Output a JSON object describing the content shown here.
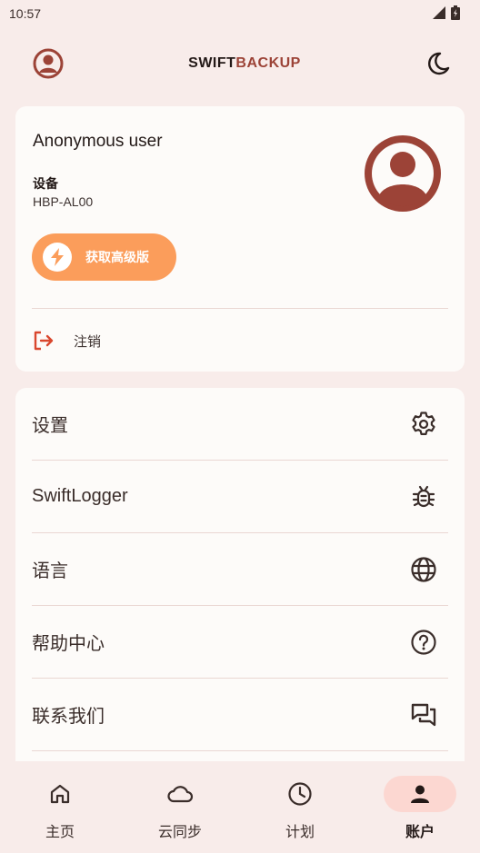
{
  "status_bar": {
    "time": "10:57"
  },
  "app_bar": {
    "title_part1": "SWIFT",
    "title_part2": "BACKUP"
  },
  "profile": {
    "user_name": "Anonymous user",
    "device_label": "设备",
    "device_value": "HBP-AL00",
    "premium_button": "获取高级版",
    "logout_label": "注销"
  },
  "menu": {
    "items": [
      {
        "label": "设置",
        "icon": "gear-icon"
      },
      {
        "label": "SwiftLogger",
        "icon": "bug-icon"
      },
      {
        "label": "语言",
        "icon": "globe-icon"
      },
      {
        "label": "帮助中心",
        "icon": "help-circle-icon"
      },
      {
        "label": "联系我们",
        "icon": "chat-icon"
      }
    ]
  },
  "bottom_nav": {
    "items": [
      {
        "label": "主页",
        "icon": "home-icon"
      },
      {
        "label": "云同步",
        "icon": "cloud-icon"
      },
      {
        "label": "计划",
        "icon": "clock-icon"
      },
      {
        "label": "账户",
        "icon": "person-icon"
      }
    ],
    "active_index": 3
  },
  "colors": {
    "background": "#f8ecea",
    "brand": "#9c4337",
    "premium": "#fb9d5b",
    "logout_icon": "#d9472e",
    "nav_active": "#fcd7d1"
  }
}
